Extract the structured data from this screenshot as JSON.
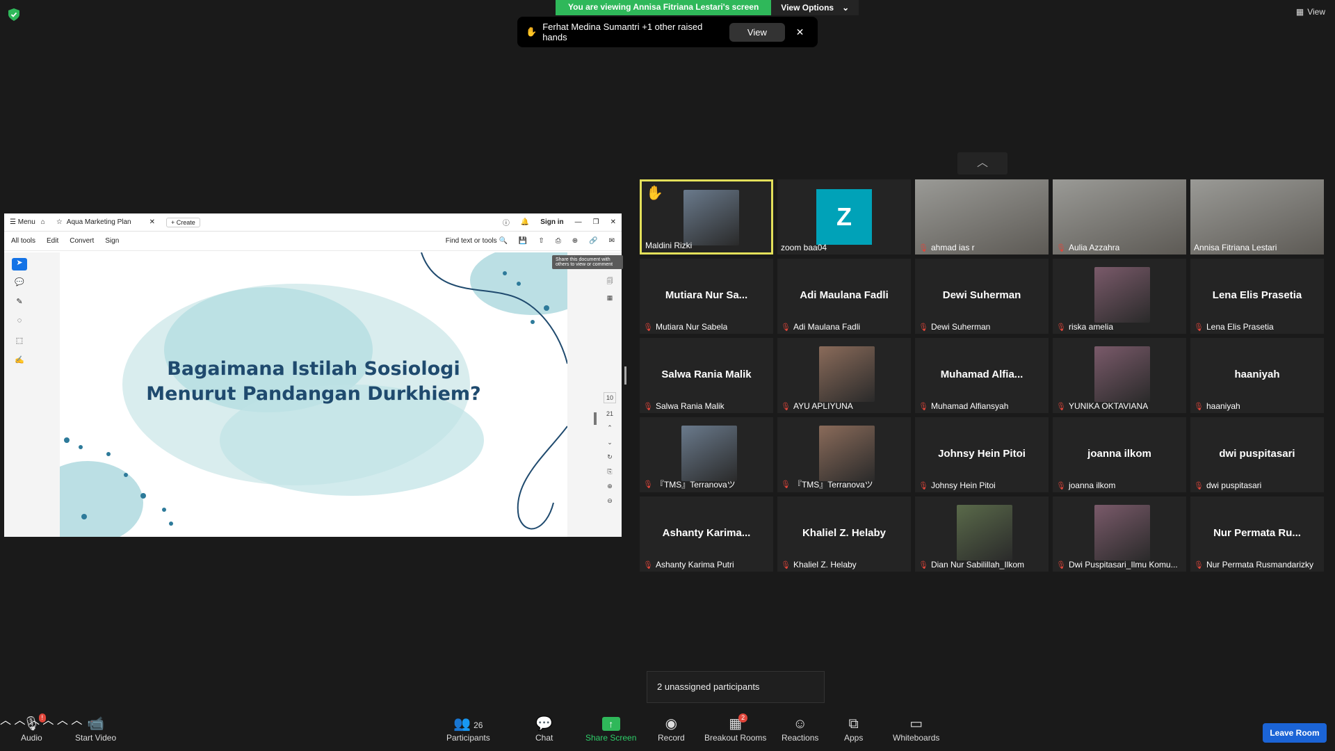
{
  "banner": {
    "viewing_text": "You are viewing Annisa Fitriana Lestari's screen",
    "view_options": "View Options",
    "top_right_view": "View"
  },
  "raised_hands": {
    "text": "Ferhat Medina Sumantri +1 other raised hands",
    "view_button": "View"
  },
  "document": {
    "menu": "Menu",
    "tab_title": "Aqua Marketing Plan",
    "create": "Create",
    "sign_in": "Sign in",
    "menubar": [
      "All tools",
      "Edit",
      "Convert",
      "Sign"
    ],
    "find": "Find text or tools",
    "tooltip": "Share this document with others to view or comment",
    "slide_title_line1": "Bagaimana Istilah Sosiologi",
    "slide_title_line2": "Menurut Pandangan Durkhiem?",
    "page_current": "10",
    "page_total": "21"
  },
  "gallery": {
    "tiles": [
      {
        "label": "Maldini Rizki",
        "muted": false,
        "kind": "photo",
        "active": true,
        "hand": true
      },
      {
        "label": "zoom baa04",
        "muted": false,
        "kind": "letter",
        "letter": "Z"
      },
      {
        "label": "ahmad ias r",
        "muted": true,
        "kind": "video"
      },
      {
        "label": "Aulia Azzahra",
        "muted": true,
        "kind": "video"
      },
      {
        "label": "Annisa Fitriana Lestari",
        "muted": false,
        "kind": "video"
      },
      {
        "big": "Mutiara  Nur  Sa...",
        "label": "Mutiara Nur Sabela",
        "muted": true,
        "kind": "name"
      },
      {
        "big": "Adi Maulana Fadli",
        "label": "Adi Maulana Fadli",
        "muted": true,
        "kind": "name"
      },
      {
        "big": "Dewi Suherman",
        "label": "Dewi Suherman",
        "muted": true,
        "kind": "name"
      },
      {
        "label": "riska amelia",
        "muted": true,
        "kind": "photo"
      },
      {
        "big": "Lena Elis Prasetia",
        "label": "Lena Elis Prasetia",
        "muted": true,
        "kind": "name"
      },
      {
        "big": "Salwa Rania Malik",
        "label": "Salwa Rania Malik",
        "muted": true,
        "kind": "name"
      },
      {
        "label": "AYU APLIYUNA",
        "muted": true,
        "kind": "photo"
      },
      {
        "big": "Muhamad  Alfia...",
        "label": "Muhamad Alfiansyah",
        "muted": true,
        "kind": "name"
      },
      {
        "label": "YUNIKA OKTAVIANA",
        "muted": true,
        "kind": "photo"
      },
      {
        "big": "haaniyah",
        "label": "haaniyah",
        "muted": true,
        "kind": "name"
      },
      {
        "label": "『TMS』Terranovaツ",
        "muted": true,
        "kind": "photo"
      },
      {
        "label": "『TMS』Terranovaツ",
        "muted": true,
        "kind": "photo"
      },
      {
        "big": "Johnsy Hein Pitoi",
        "label": "Johnsy Hein Pitoi",
        "muted": true,
        "kind": "name"
      },
      {
        "big": "joanna ilkom",
        "label": "joanna ilkom",
        "muted": true,
        "kind": "name"
      },
      {
        "big": "dwi puspitasari",
        "label": "dwi puspitasari",
        "muted": true,
        "kind": "name"
      },
      {
        "big": "Ashanty  Karima...",
        "label": "Ashanty Karima Putri",
        "muted": true,
        "kind": "name"
      },
      {
        "big": "Khaliel Z. Helaby",
        "label": "Khaliel Z. Helaby",
        "muted": true,
        "kind": "name"
      },
      {
        "label": "Dian Nur Sabilillah_Ilkom",
        "muted": true,
        "kind": "photo"
      },
      {
        "label": "Dwi Puspitasari_Ilmu Komu...",
        "muted": true,
        "kind": "photo"
      },
      {
        "big": "Nur Permata Ru...",
        "label": "Nur Permata Rusmandarizky",
        "muted": true,
        "kind": "name"
      }
    ]
  },
  "unassigned": "2 unassigned participants",
  "toolbar": {
    "audio": "Audio",
    "audio_badge": "!",
    "start_video": "Start Video",
    "participants": "Participants",
    "participants_count": "26",
    "chat": "Chat",
    "share_screen": "Share Screen",
    "record": "Record",
    "breakout": "Breakout Rooms",
    "breakout_badge": "2",
    "reactions": "Reactions",
    "apps": "Apps",
    "whiteboards": "Whiteboards",
    "leave": "Leave Room"
  },
  "colors": {
    "banner_green": "#2fb85a",
    "active_border": "#e3e05a",
    "leave_blue": "#1b64d6",
    "muted_red": "#e0453a"
  }
}
